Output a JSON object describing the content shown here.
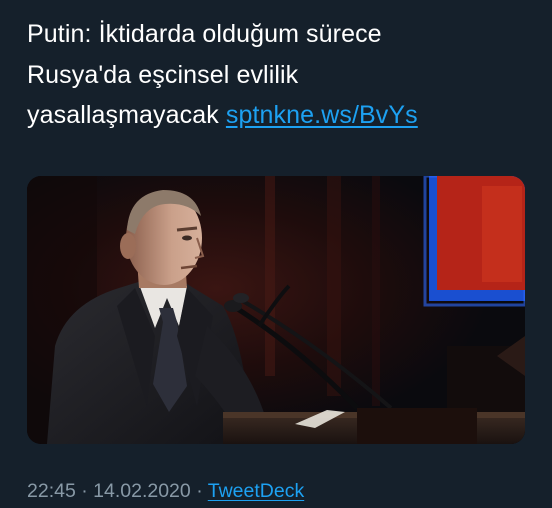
{
  "tweet": {
    "line1": "Putin: İktidarda olduğum sürece",
    "line2": "Rusya'da eşcinsel evlilik",
    "line3": "yasallaşmayacak",
    "link_text": "sptnkne.ws/BvYs"
  },
  "media": {
    "icon": "photo-man-speaking-at-podium"
  },
  "meta": {
    "time": "22:45",
    "separator1": "·",
    "date": "14.02.2020",
    "separator2": "·",
    "source": "TweetDeck"
  },
  "colors": {
    "background": "#15202b",
    "text": "#ffffff",
    "link": "#1da1f2",
    "muted": "#8899a6"
  }
}
